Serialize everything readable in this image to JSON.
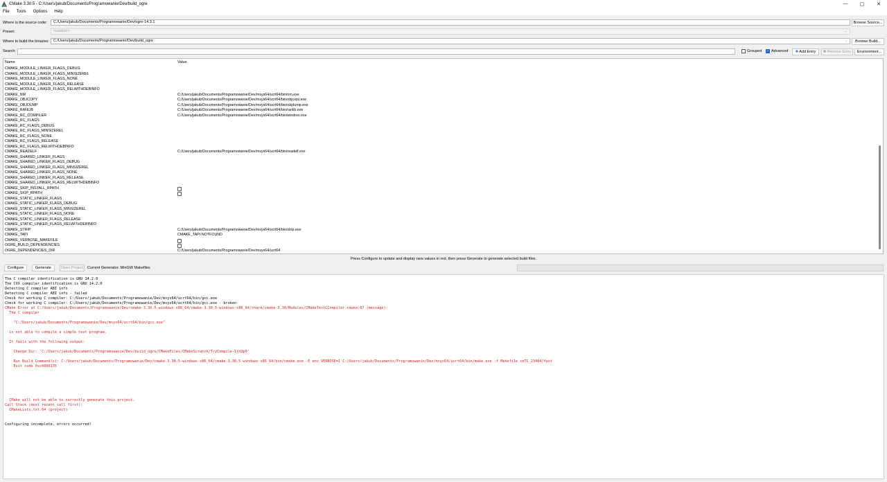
{
  "window": {
    "title": "CMake 3.30.5 - C:/Users/jakub/Documents/Programowanie/Dev/build_ogre",
    "controls": {
      "minimize": "—",
      "maximize": "▢",
      "close": "✕"
    }
  },
  "menu": [
    "File",
    "Tools",
    "Options",
    "Help"
  ],
  "source": {
    "label": "Where is the source code:",
    "value": "C:/Users/jakub/Documents/Programowanie/Dev/ogre-14.3.1",
    "button": "Browse Source..."
  },
  "preset": {
    "label": "Preset:",
    "value": "<custom>"
  },
  "build": {
    "label": "Where to build the binaries:",
    "value": "C:/Users/jakub/Documents/Programowanie/Dev/build_ogre",
    "button": "Browse Build..."
  },
  "search": {
    "label": "Search:",
    "value": ""
  },
  "toolbar": {
    "grouped": "Grouped",
    "advanced": "Advanced",
    "add_entry": "Add Entry",
    "remove_entry": "Remove Entry",
    "environment": "Environment..."
  },
  "table": {
    "col_name": "Name",
    "col_value": "Value",
    "rows": [
      {
        "name": "CMAKE_MODULE_LINKER_FLAGS_DEBUG",
        "value": ""
      },
      {
        "name": "CMAKE_MODULE_LINKER_FLAGS_MINSIZEREL",
        "value": ""
      },
      {
        "name": "CMAKE_MODULE_LINKER_FLAGS_NONE",
        "value": ""
      },
      {
        "name": "CMAKE_MODULE_LINKER_FLAGS_RELEASE",
        "value": ""
      },
      {
        "name": "CMAKE_MODULE_LINKER_FLAGS_RELWITHDEBINFO",
        "value": ""
      },
      {
        "name": "CMAKE_NM",
        "value": "C:/Users/jakub/Documents/Programowanie/Dev/msys64/ucrt64/bin/nm.exe"
      },
      {
        "name": "CMAKE_OBJCOPY",
        "value": "C:/Users/jakub/Documents/Programowanie/Dev/msys64/ucrt64/bin/objcopy.exe"
      },
      {
        "name": "CMAKE_OBJDUMP",
        "value": "C:/Users/jakub/Documents/Programowanie/Dev/msys64/ucrt64/bin/objdump.exe"
      },
      {
        "name": "CMAKE_RANLIB",
        "value": "C:/Users/jakub/Documents/Programowanie/Dev/msys64/ucrt64/bin/ranlib.exe"
      },
      {
        "name": "CMAKE_RC_COMPILER",
        "value": "C:/Users/jakub/Documents/Programowanie/Dev/msys64/ucrt64/bin/windres.exe"
      },
      {
        "name": "CMAKE_RC_FLAGS",
        "value": ""
      },
      {
        "name": "CMAKE_RC_FLAGS_DEBUG",
        "value": ""
      },
      {
        "name": "CMAKE_RC_FLAGS_MINSIZEREL",
        "value": ""
      },
      {
        "name": "CMAKE_RC_FLAGS_NONE",
        "value": ""
      },
      {
        "name": "CMAKE_RC_FLAGS_RELEASE",
        "value": ""
      },
      {
        "name": "CMAKE_RC_FLAGS_RELWITHDEBINFO",
        "value": ""
      },
      {
        "name": "CMAKE_READELF",
        "value": "C:/Users/jakub/Documents/Programowanie/Dev/msys64/ucrt64/bin/readelf.exe"
      },
      {
        "name": "CMAKE_SHARED_LINKER_FLAGS",
        "value": ""
      },
      {
        "name": "CMAKE_SHARED_LINKER_FLAGS_DEBUG",
        "value": ""
      },
      {
        "name": "CMAKE_SHARED_LINKER_FLAGS_MINSIZEREL",
        "value": ""
      },
      {
        "name": "CMAKE_SHARED_LINKER_FLAGS_NONE",
        "value": ""
      },
      {
        "name": "CMAKE_SHARED_LINKER_FLAGS_RELEASE",
        "value": ""
      },
      {
        "name": "CMAKE_SHARED_LINKER_FLAGS_RELWITHDEBINFO",
        "value": ""
      },
      {
        "name": "CMAKE_SKIP_INSTALL_RPATH",
        "value": "",
        "checkbox": true
      },
      {
        "name": "CMAKE_SKIP_RPATH",
        "value": "",
        "checkbox": true
      },
      {
        "name": "CMAKE_STATIC_LINKER_FLAGS",
        "value": ""
      },
      {
        "name": "CMAKE_STATIC_LINKER_FLAGS_DEBUG",
        "value": ""
      },
      {
        "name": "CMAKE_STATIC_LINKER_FLAGS_MINSIZEREL",
        "value": ""
      },
      {
        "name": "CMAKE_STATIC_LINKER_FLAGS_NONE",
        "value": ""
      },
      {
        "name": "CMAKE_STATIC_LINKER_FLAGS_RELEASE",
        "value": ""
      },
      {
        "name": "CMAKE_STATIC_LINKER_FLAGS_RELWITHDEBINFO",
        "value": ""
      },
      {
        "name": "CMAKE_STRIP",
        "value": "C:/Users/jakub/Documents/Programowanie/Dev/msys64/ucrt64/bin/strip.exe"
      },
      {
        "name": "CMAKE_TAPI",
        "value": "CMAKE_TAPI-NOTFOUND"
      },
      {
        "name": "CMAKE_VERBOSE_MAKEFILE",
        "value": "",
        "checkbox": true
      },
      {
        "name": "OGRE_BUILD_DEPENDENCIES",
        "value": "",
        "checkbox": true
      },
      {
        "name": "OGRE_DEPENDENCIES_DIR",
        "value": "C:/Users/jakub/Documents/Programowanie/Dev/msys64/ucrt64"
      }
    ]
  },
  "hint": "Press Configure to update and display new values in red, then press Generate to generate selected build files.",
  "actions": {
    "configure": "Configure",
    "generate": "Generate",
    "open_project": "Open Project",
    "generator": "Current Generator: MinGW Makefiles"
  },
  "output": [
    {
      "text": "The C compiler identification is GNU 14.2.0",
      "error": false
    },
    {
      "text": "The CXX compiler identification is GNU 14.2.0",
      "error": false
    },
    {
      "text": "Detecting C compiler ABI info",
      "error": false
    },
    {
      "text": "Detecting C compiler ABI info - failed",
      "error": false
    },
    {
      "text": "Check for working C compiler: C:/Users/jakub/Documents/Programowanie/Dev/msys64/ucrt64/bin/gcc.exe",
      "error": false
    },
    {
      "text": "Check for working C compiler: C:/Users/jakub/Documents/Programowanie/Dev/msys64/ucrt64/bin/gcc.exe - broken",
      "error": false
    },
    {
      "text": "CMake Error at C:/Users/jakub/Documents/Programowanie/Dev/cmake-3.30.5-windows-x86_64/cmake-3.30.5-windows-x86_64/share/cmake-3.30/Modules/CMakeTestCCompiler.cmake:67 (message):",
      "error": true
    },
    {
      "text": "  The C compiler",
      "error": true
    },
    {
      "text": "",
      "error": true
    },
    {
      "text": "    \"C:/Users/jakub/Documents/Programowanie/Dev/msys64/ucrt64/bin/gcc.exe\"",
      "error": true
    },
    {
      "text": "",
      "error": true
    },
    {
      "text": "  is not able to compile a simple test program.",
      "error": true
    },
    {
      "text": "",
      "error": true
    },
    {
      "text": "  It fails with the following output:",
      "error": true
    },
    {
      "text": "",
      "error": true
    },
    {
      "text": "    Change Dir: 'C:/Users/jakub/Documents/Programowanie/Dev/build_ogre/CMakeFiles/CMakeScratch/TryCompile-1tn3p0'",
      "error": true
    },
    {
      "text": "",
      "error": true
    },
    {
      "text": "    Run Build Command(s): C:/Users/jakub/Documents/Programowanie/Dev/cmake-3.30.5-windows-x86_64/cmake-3.30.5-windows-x86_64/bin/cmake.exe -E env VERBOSE=1 C:/Users/jakub/Documents/Programowanie/Dev/msys64/ucrt64/bin/make.exe -f Makefile cmTC_23404/fast",
      "error": true
    },
    {
      "text": "    Exit code 0xc0000135",
      "error": true
    },
    {
      "text": "",
      "error": true
    },
    {
      "text": "",
      "error": true
    },
    {
      "text": "",
      "error": true
    },
    {
      "text": "",
      "error": true
    },
    {
      "text": "",
      "error": true
    },
    {
      "text": "",
      "error": true
    },
    {
      "text": "  CMake will not be able to correctly generate this project.",
      "error": true
    },
    {
      "text": "Call Stack (most recent call first):",
      "error": true
    },
    {
      "text": "  CMakeLists.txt:64 (project)",
      "error": true
    },
    {
      "text": "",
      "error": false
    },
    {
      "text": "",
      "error": false
    },
    {
      "text": "Configuring incomplete, errors occurred!",
      "error": false
    }
  ]
}
